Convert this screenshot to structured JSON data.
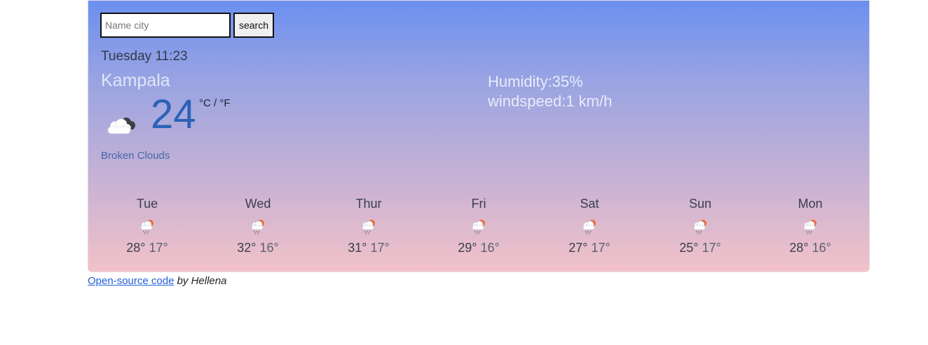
{
  "search": {
    "placeholder": "Name city",
    "value": "",
    "button_label": "search"
  },
  "current": {
    "date_time": "Tuesday 11:23",
    "city": "Kampala",
    "temperature": "24",
    "units": "°C / °F",
    "description": "Broken Clouds",
    "icon": "broken-clouds-icon",
    "humidity": "Humidity:35%",
    "windspeed": "windspeed:1 km/h"
  },
  "forecast": [
    {
      "day": "Tue",
      "max": "28°",
      "min": "17°",
      "icon": "rain-cloud-sun-icon"
    },
    {
      "day": "Wed",
      "max": "32°",
      "min": "16°",
      "icon": "rain-cloud-sun-icon"
    },
    {
      "day": "Thur",
      "max": "31°",
      "min": "17°",
      "icon": "rain-cloud-sun-icon"
    },
    {
      "day": "Fri",
      "max": "29°",
      "min": "16°",
      "icon": "rain-cloud-sun-icon"
    },
    {
      "day": "Sat",
      "max": "27°",
      "min": "17°",
      "icon": "rain-cloud-sun-icon"
    },
    {
      "day": "Sun",
      "max": "25°",
      "min": "17°",
      "icon": "rain-cloud-sun-icon"
    },
    {
      "day": "Mon",
      "max": "28°",
      "min": "16°",
      "icon": "rain-cloud-sun-icon"
    }
  ],
  "footer": {
    "link_text": "Open-source code",
    "by_text": "by Hellena"
  },
  "colors": {
    "gradient_top": "#6b8ff0",
    "gradient_bottom": "#f2c2c8",
    "temperature": "#2a62b6",
    "link": "#1f5fd6"
  }
}
